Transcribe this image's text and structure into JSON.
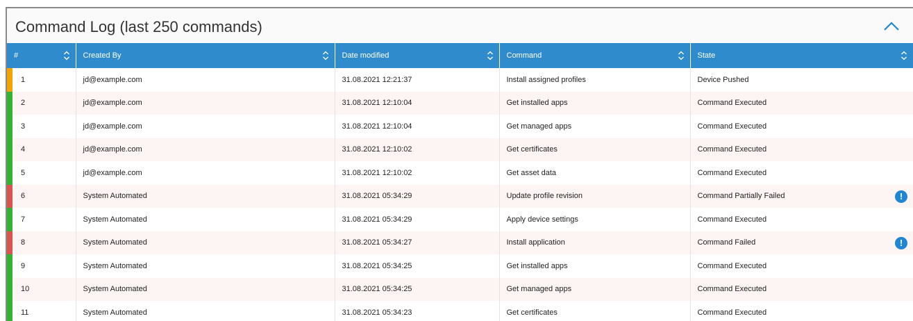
{
  "panel": {
    "title": "Command Log (last 250 commands)"
  },
  "colors": {
    "header_bg": "#2f8bcb",
    "status_pending": "#f5a300",
    "status_success": "#33b233",
    "status_failed": "#d9534f",
    "alert_icon": "#1f86d6"
  },
  "table": {
    "columns": [
      "#",
      "Created By",
      "Date modified",
      "Command",
      "State"
    ],
    "rows": [
      {
        "num": "1",
        "created_by": "jd@example.com",
        "date": "31.08.2021 12:21:37",
        "command": "Install assigned profiles",
        "state": "Device Pushed",
        "status": "pending",
        "alert": false
      },
      {
        "num": "2",
        "created_by": "jd@example.com",
        "date": "31.08.2021 12:10:04",
        "command": "Get installed apps",
        "state": "Command Executed",
        "status": "success",
        "alert": false
      },
      {
        "num": "3",
        "created_by": "jd@example.com",
        "date": "31.08.2021 12:10:04",
        "command": "Get managed apps",
        "state": "Command Executed",
        "status": "success",
        "alert": false
      },
      {
        "num": "4",
        "created_by": "jd@example.com",
        "date": "31.08.2021 12:10:02",
        "command": "Get certificates",
        "state": "Command Executed",
        "status": "success",
        "alert": false
      },
      {
        "num": "5",
        "created_by": "jd@example.com",
        "date": "31.08.2021 12:10:02",
        "command": "Get asset data",
        "state": "Command Executed",
        "status": "success",
        "alert": false
      },
      {
        "num": "6",
        "created_by": "System Automated",
        "date": "31.08.2021 05:34:29",
        "command": "Update profile revision",
        "state": "Command Partially Failed",
        "status": "failed",
        "alert": true
      },
      {
        "num": "7",
        "created_by": "System Automated",
        "date": "31.08.2021 05:34:29",
        "command": "Apply device settings",
        "state": "Command Executed",
        "status": "success",
        "alert": false
      },
      {
        "num": "8",
        "created_by": "System Automated",
        "date": "31.08.2021 05:34:27",
        "command": "Install application",
        "state": "Command Failed",
        "status": "failed",
        "alert": true
      },
      {
        "num": "9",
        "created_by": "System Automated",
        "date": "31.08.2021 05:34:25",
        "command": "Get installed apps",
        "state": "Command Executed",
        "status": "success",
        "alert": false
      },
      {
        "num": "10",
        "created_by": "System Automated",
        "date": "31.08.2021 05:34:25",
        "command": "Get managed apps",
        "state": "Command Executed",
        "status": "success",
        "alert": false
      },
      {
        "num": "11",
        "created_by": "System Automated",
        "date": "31.08.2021 05:34:23",
        "command": "Get certificates",
        "state": "Command Executed",
        "status": "success",
        "alert": false
      }
    ],
    "alert_glyph": "!",
    "sort_icon": "sort-icon",
    "collapse_icon": "chevron-up-icon"
  }
}
